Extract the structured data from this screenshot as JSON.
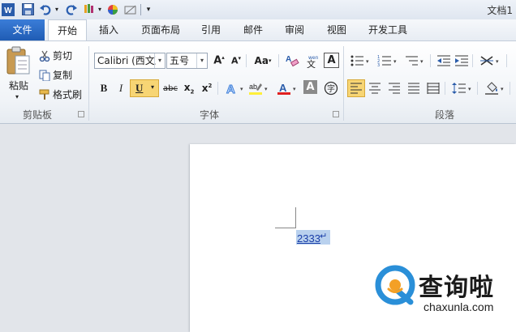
{
  "window": {
    "title": "文档1"
  },
  "tabs": [
    "文件",
    "开始",
    "插入",
    "页面布局",
    "引用",
    "邮件",
    "审阅",
    "视图",
    "开发工具"
  ],
  "clipboard": {
    "paste": "粘贴",
    "cut": "剪切",
    "copy": "复制",
    "format_painter": "格式刷",
    "group_label": "剪贴板"
  },
  "font": {
    "family": "Calibri (西文正",
    "size": "五号",
    "change_case": "Aa",
    "group_label": "字体"
  },
  "paragraph": {
    "group_label": "段落"
  },
  "document": {
    "text": "2333",
    "para_mark": "↵"
  },
  "watermark": {
    "name": "查询啦",
    "url": "chaxunla.com"
  },
  "colors": {
    "accent": "#1f5cb4",
    "file_tab": "#2b6cc4",
    "selection": "#b9d1ee",
    "underline_active": "#f7d574"
  }
}
